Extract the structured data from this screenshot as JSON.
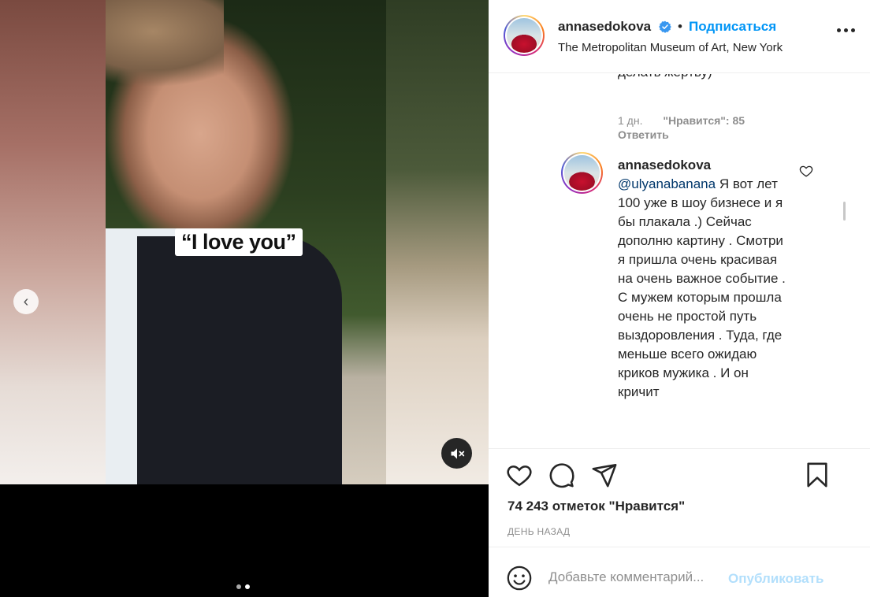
{
  "media": {
    "caption": "“I love you”",
    "nav_prev_glyph": "‹",
    "icons": {
      "prev": "chevron-left-icon",
      "mute": "speaker-muted-icon"
    },
    "carousel": {
      "count": 2,
      "active_index": 1
    }
  },
  "header": {
    "username": "annasedokova",
    "verified": true,
    "bullet": "•",
    "follow_label": "Подписаться",
    "location": "The Metropolitan Museum of Art, New York"
  },
  "comments": {
    "previous": {
      "text_tail": "делать жертву)",
      "date": "1 дн.",
      "likes": "\"Нравится\": 85",
      "reply_label": "Ответить"
    },
    "current": {
      "username": "annasedokova",
      "mention": "@ulyanabanana",
      "text": "Я вот лет 100 уже в шоу бизнесе и я бы плакала .) Сейчас дополню картину . Смотри я пришла очень красивая на очень важное событие . С мужем которым прошла очень не простой путь выздоровления . Туда, где меньше всего ожидаю криков мужика . И он кричит"
    }
  },
  "actions": {
    "icons": [
      "heart-icon",
      "comment-icon",
      "share-icon",
      "bookmark-icon"
    ],
    "likes_text": "74 243 отметок \"Нравится\"",
    "time": "ДЕНЬ НАЗАД"
  },
  "compose": {
    "placeholder": "Добавьте комментарий...",
    "publish_label": "Опубликовать"
  },
  "colors": {
    "accent": "#0095f6",
    "publish_disabled": "#b2dffc",
    "text": "#262626",
    "secondary": "#8e8e8e"
  }
}
